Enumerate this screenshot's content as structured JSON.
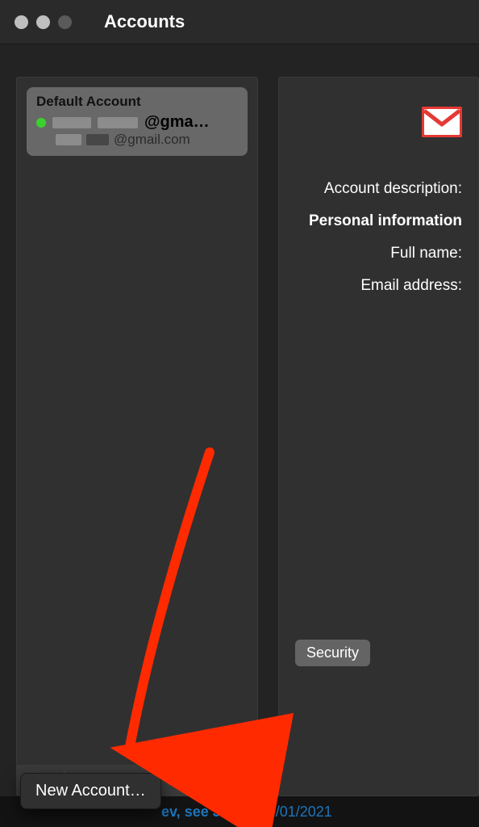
{
  "window": {
    "title": "Accounts"
  },
  "sidebar": {
    "account": {
      "title": "Default Account",
      "status_color": "#3ad12e",
      "email_visible_suffix": "@gma…",
      "secondary_visible_suffix": "@gmail.com"
    },
    "popup": {
      "new_account": "New Account…"
    }
  },
  "detail": {
    "account_description_label": "Account description:",
    "personal_info_header": "Personal information",
    "full_name_label": "Full name:",
    "email_label": "Email address:",
    "security_button": "Security",
    "icon": "gmail"
  },
  "bottombar": {
    "text": "ev, see J…",
    "date": "09/01/2021"
  }
}
